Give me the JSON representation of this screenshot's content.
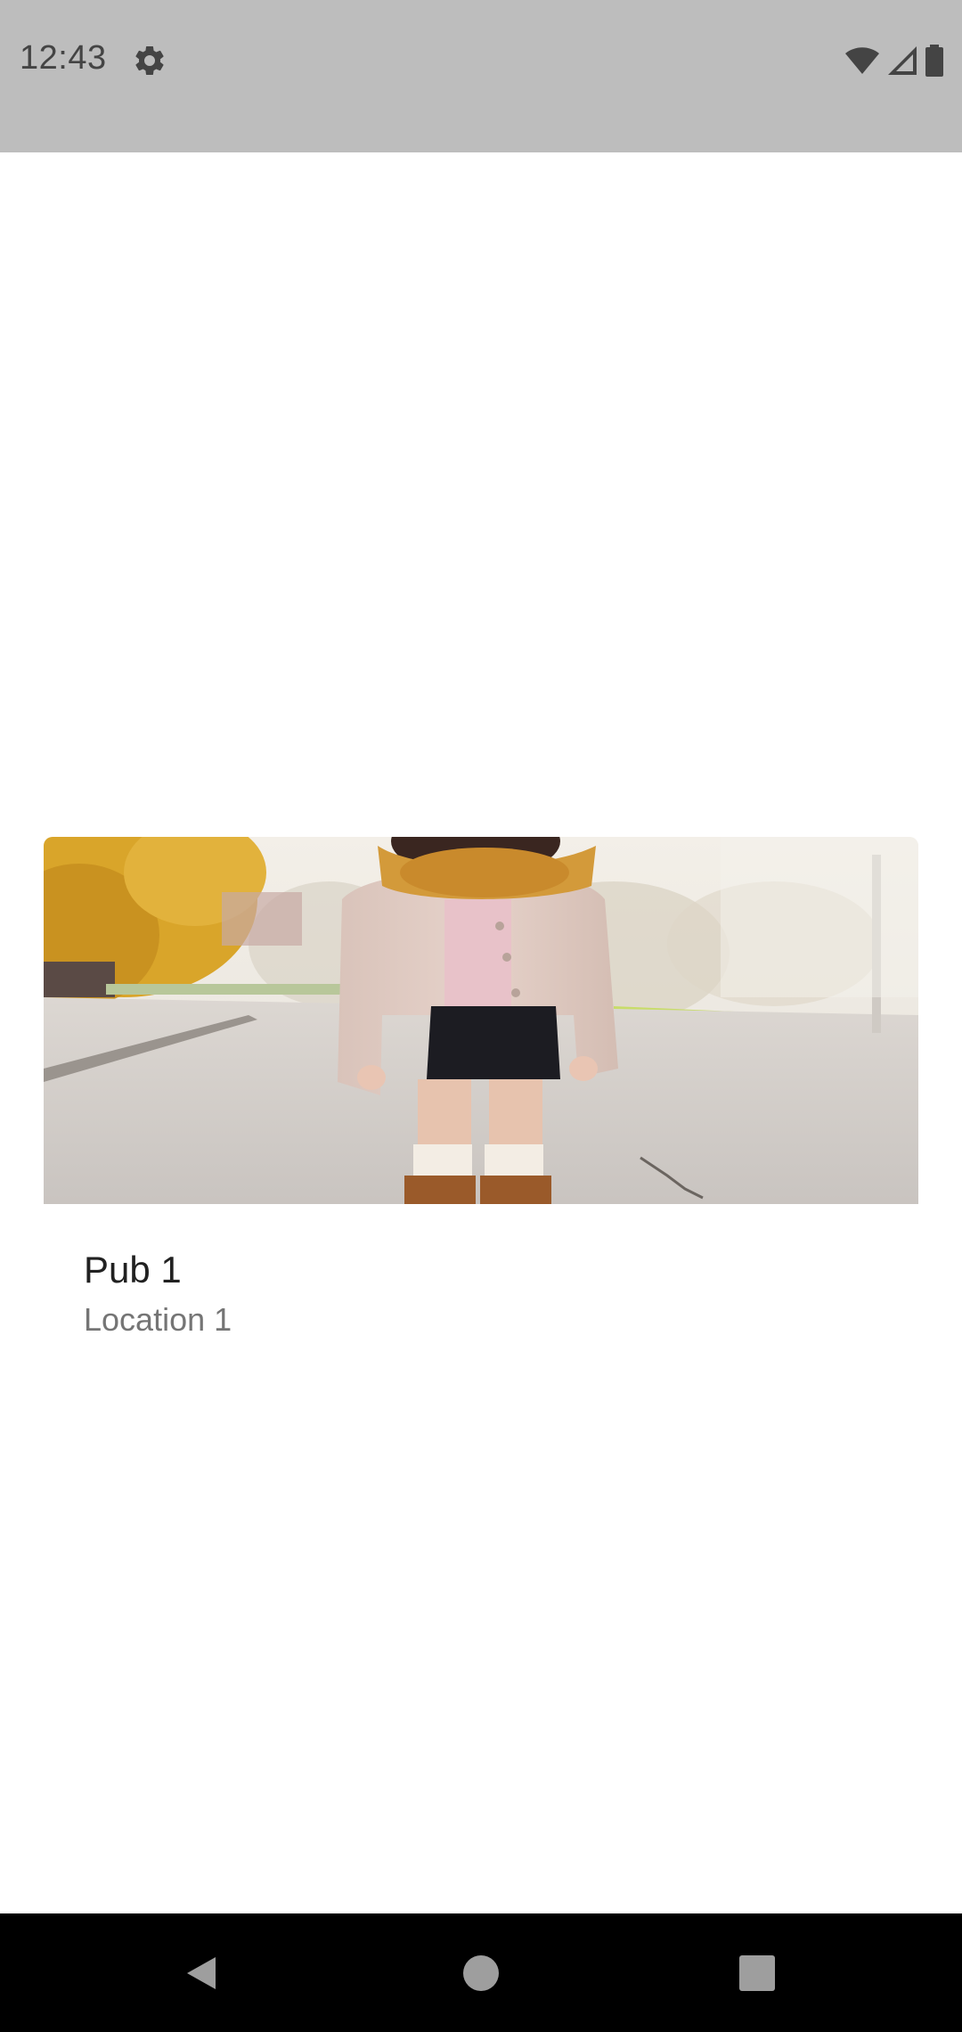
{
  "status_bar": {
    "time": "12:43",
    "icons": [
      "gear-icon",
      "wifi-icon",
      "signal-icon",
      "battery-icon"
    ]
  },
  "card": {
    "title": "Pub 1",
    "subtitle": "Location 1",
    "image": "photo of a person in a beige coat, orange scarf, skirt and brown boots on an autumn street"
  },
  "nav_bar": {
    "buttons": [
      "back-icon",
      "home-icon",
      "recents-icon"
    ]
  },
  "colors": {
    "status_bar_bg": "#bdbdbd",
    "nav_bar_bg": "#000000",
    "title": "#212121",
    "subtitle": "#757575"
  }
}
